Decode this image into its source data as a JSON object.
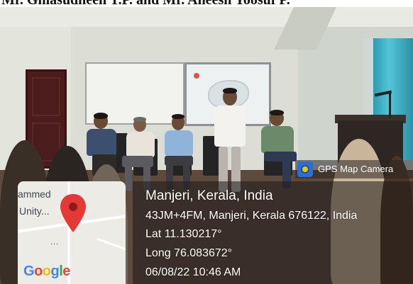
{
  "caption": "Mr. Ghiasudheen T.P. and Mr. Aneesh Yoosuf P.",
  "gps_badge": {
    "label": "GPS Map Camera"
  },
  "location": {
    "title": "Manjeri, Kerala, India",
    "address": "43JM+4FM, Manjeri, Kerala 676122, India",
    "lat": "Lat 11.130217°",
    "long": "Long 76.083672°",
    "datetime": "06/08/22 10:46 AM"
  },
  "map": {
    "label_line1": "ammed",
    "label_line2": "Unity...",
    "dots": "...",
    "logo": {
      "g1": "G",
      "o1": "o",
      "o2": "o",
      "g2": "g",
      "l": "l",
      "e": "e"
    },
    "pin_color": "#e53935"
  },
  "colors": {
    "curtain": "#2a9bb3",
    "door": "#4a1c1c",
    "panel_overlay": "#1e1a18"
  }
}
